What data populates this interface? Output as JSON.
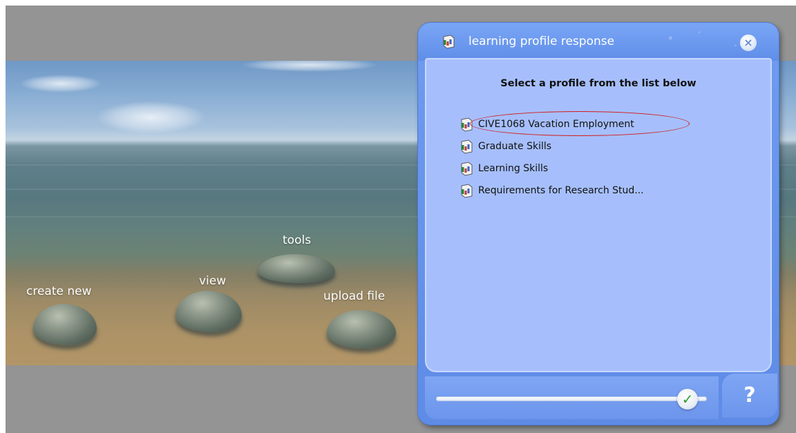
{
  "scene": {
    "stones": [
      {
        "label": "create new"
      },
      {
        "label": "view"
      },
      {
        "label": "tools"
      },
      {
        "label": "upload file"
      }
    ]
  },
  "dialog": {
    "title": "learning profile response",
    "close_icon": "close-icon",
    "heading": "Select a profile from the list below",
    "profiles": [
      {
        "label": "CIVE1068 Vacation Employment",
        "highlighted": true
      },
      {
        "label": "Graduate Skills",
        "highlighted": false
      },
      {
        "label": "Learning Skills",
        "highlighted": false
      },
      {
        "label": "Requirements for Research Stud...",
        "highlighted": false
      }
    ],
    "slider_icon": "checkmark-icon",
    "help_label": "?",
    "highlight_color": "#d41a1a",
    "accent_color": "#6f9cf0",
    "panel_color": "#a6bffc"
  }
}
